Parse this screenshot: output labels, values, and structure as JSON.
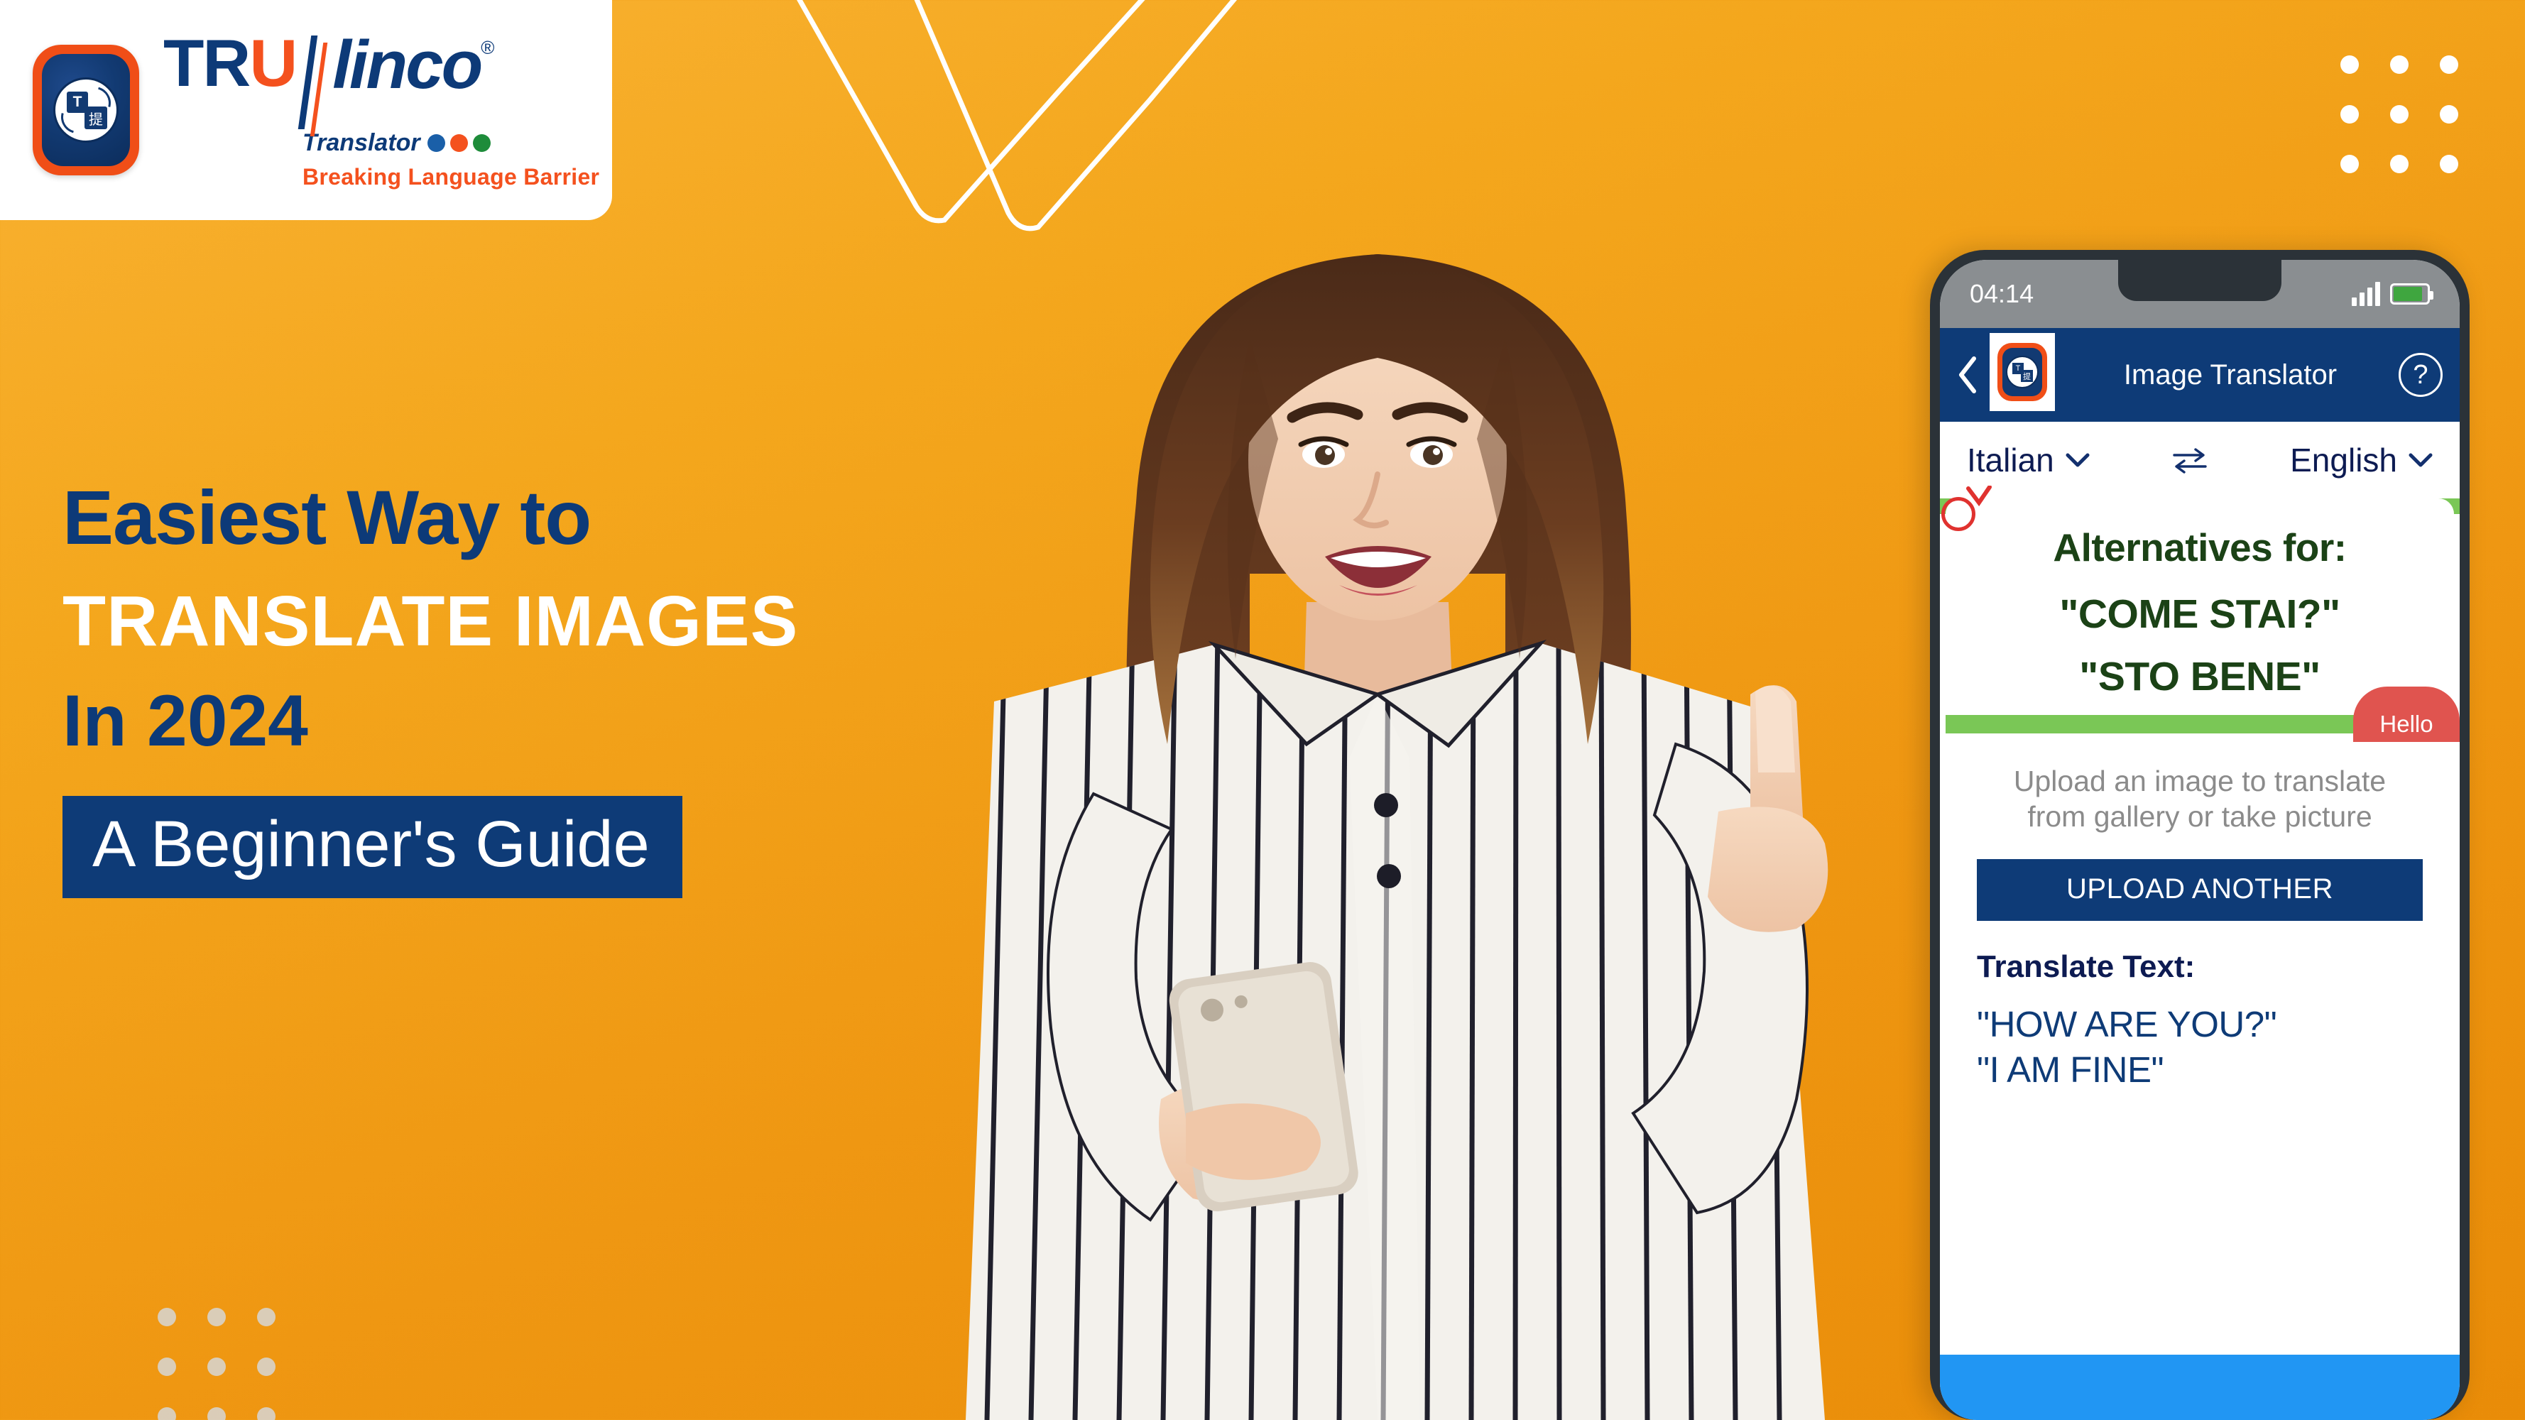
{
  "brand": {
    "name_part1": "TR",
    "name_part2": "U",
    "name_part3": "linco",
    "registered": "®",
    "sub_word": "Translator",
    "tagline": "Breaking Language Barrier",
    "icon_glyph_latin": "T",
    "icon_glyph_cjk": "提",
    "colors": {
      "navy": "#0d3a78",
      "orange": "#f4511e",
      "background_orange": "#f4a71d"
    }
  },
  "headline": {
    "line1": "Easiest Way to",
    "line2": "TRANSLATE IMAGES",
    "line3": "In 2024",
    "subtitle_box": "A Beginner's Guide"
  },
  "phone": {
    "status_bar": {
      "time": "04:14",
      "signal_icon": "signal-bars-icon",
      "battery_icon": "battery-icon"
    },
    "app_bar": {
      "back_icon": "back-chevron-icon",
      "title": "Image Translator",
      "help_label": "?"
    },
    "languages": {
      "source": "Italian",
      "target": "English",
      "swap_icon": "swap-arrows-icon",
      "chevron_icon": "chevron-down-icon"
    },
    "result_card": {
      "heading": "Alternatives for:",
      "phrase1": "\"COME STAI?\"",
      "phrase2": "\"STO BENE\"",
      "badge": "Hello"
    },
    "upload": {
      "note_line1": "Upload an image to translate",
      "note_line2": "from gallery or take picture",
      "button_label": "UPLOAD ANOTHER"
    },
    "translation": {
      "label": "Translate Text:",
      "line1": "\"HOW ARE YOU?\"",
      "line2": "\"I AM FINE\""
    }
  },
  "decor": {
    "dots_top_right": "dot-grid-icon",
    "dots_bottom_left": "dot-grid-icon",
    "chevron_lines": "decorative-lines"
  }
}
